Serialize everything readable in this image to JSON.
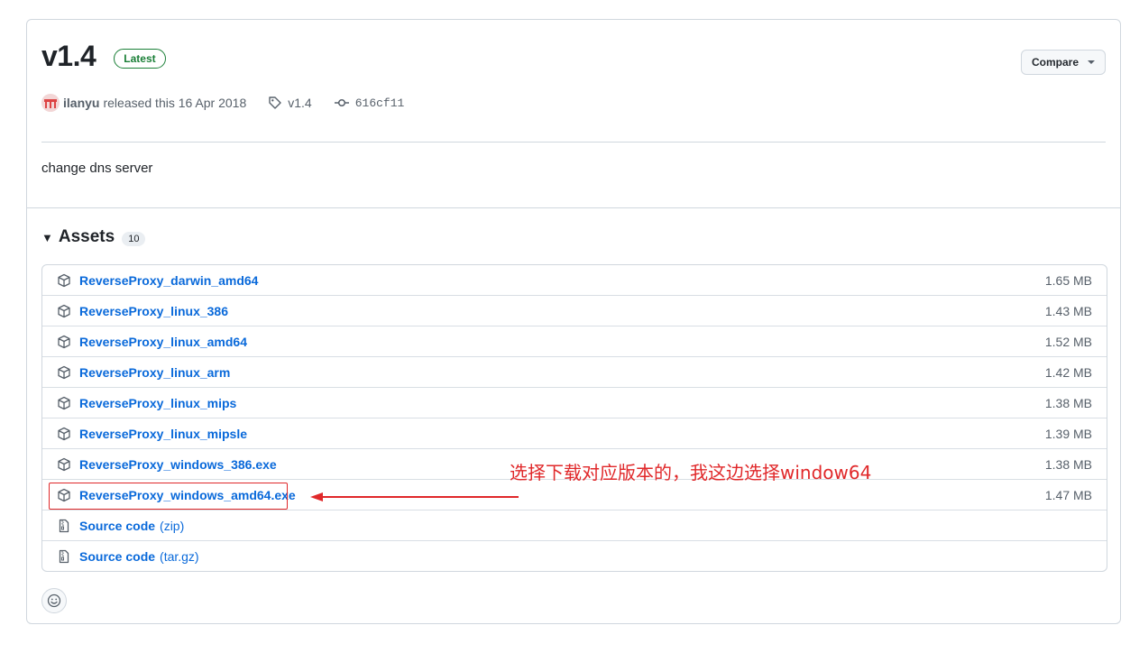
{
  "release": {
    "version": "v1.4",
    "badge": "Latest",
    "compare_label": "Compare",
    "author": "ilanyu",
    "released_text": "released this 16 Apr 2018",
    "tag": "v1.4",
    "commit": "616cf11",
    "body": "change dns server"
  },
  "assets": {
    "title": "Assets",
    "count": "10",
    "items": [
      {
        "name": "ReverseProxy_darwin_amd64",
        "size": "1.65 MB"
      },
      {
        "name": "ReverseProxy_linux_386",
        "size": "1.43 MB"
      },
      {
        "name": "ReverseProxy_linux_amd64",
        "size": "1.52 MB"
      },
      {
        "name": "ReverseProxy_linux_arm",
        "size": "1.42 MB"
      },
      {
        "name": "ReverseProxy_linux_mips",
        "size": "1.38 MB"
      },
      {
        "name": "ReverseProxy_linux_mipsle",
        "size": "1.39 MB"
      },
      {
        "name": "ReverseProxy_windows_386.exe",
        "size": "1.38 MB"
      },
      {
        "name": "ReverseProxy_windows_amd64.exe",
        "size": "1.47 MB"
      }
    ],
    "source": [
      {
        "name": "Source code",
        "suffix": "(zip)"
      },
      {
        "name": "Source code",
        "suffix": "(tar.gz)"
      }
    ]
  },
  "annotation": {
    "text": "选择下载对应版本的，我这边选择window64",
    "color": "#e0282a"
  },
  "icons": {
    "package": "package-icon",
    "file_zip": "file-zip-icon",
    "tag": "tag-icon",
    "commit": "git-commit-icon",
    "smiley": "smiley-icon"
  },
  "colors": {
    "link": "#0969da",
    "latest": "#1a7f37",
    "muted": "#57606a",
    "border": "#d0d7de"
  }
}
